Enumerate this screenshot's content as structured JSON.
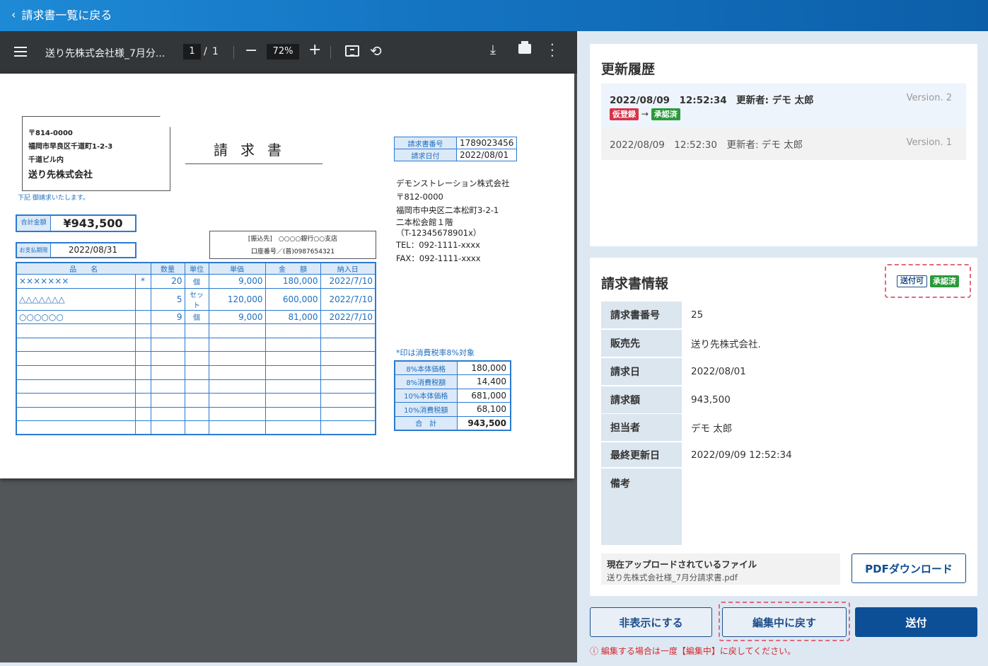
{
  "topbar": {
    "back_label": "請求書一覧に戻る"
  },
  "viewer": {
    "file_title": "送り先株式会社様_7月分...",
    "page_current": "1",
    "page_sep": "/",
    "page_total": "1",
    "zoom": "72%",
    "icons": [
      "menu-icon",
      "minus-icon",
      "plus-icon",
      "fit-page-icon",
      "rotate-icon",
      "download-icon",
      "print-icon",
      "more-vert-icon"
    ]
  },
  "invoice": {
    "postal": "〒814-0000",
    "address1": "福岡市早良区千道町1-2-3",
    "address2": "千道ビル内",
    "recipient": "送り先株式会社",
    "title": "請求書",
    "note": "下記 御請求いたします。",
    "total_label": "合計金額",
    "total_value": "¥943,500",
    "due_label": "お支払期限",
    "due_value": "2022/08/31",
    "bank_line1": "[振込先]　○○○○銀行○○支店",
    "bank_line2": "口座番号／(普)0987654321",
    "meta": {
      "number_label": "請求書番号",
      "number_value": "1789023456",
      "date_label": "請求日付",
      "date_value": "2022/08/01"
    },
    "issuer": {
      "name": "デモンストレーション株式会社",
      "postal": "〒812-0000",
      "address1": "福岡市中央区二本松町3-2-1",
      "address2": "二本松会館１階",
      "reg": "（T-12345678901x）",
      "tel": "TEL：092-1111-xxxx",
      "fax": "FAX：092-1111-xxxx"
    },
    "columns": [
      "品　　名",
      "",
      "数量",
      "単位",
      "単価",
      "金　　額",
      "納入日"
    ],
    "items": [
      [
        "×××××××",
        "*",
        "20",
        "個",
        "9,000",
        "180,000",
        "2022/7/10"
      ],
      [
        "△△△△△△△",
        "",
        "5",
        "セット",
        "120,000",
        "600,000",
        "2022/7/10"
      ],
      [
        "○○○○○○",
        "",
        "9",
        "個",
        "9,000",
        "81,000",
        "2022/7/10"
      ]
    ],
    "tax_note": "*印は消費税率8%対象",
    "tax": [
      {
        "label": "8%本体価格",
        "value": "180,000"
      },
      {
        "label": "8%消費税額",
        "value": "14,400"
      },
      {
        "label": "10%本体価格",
        "value": "681,000"
      },
      {
        "label": "10%消費税額",
        "value": "68,100"
      },
      {
        "label": "合　計",
        "value": "943,500"
      }
    ]
  },
  "history": {
    "title": "更新履歴",
    "entries": [
      {
        "text": "2022/08/09　12:52:34　更新者: デモ 太郎",
        "version": "Version. 2",
        "from": "仮登録",
        "arrow": "→",
        "to": "承認済"
      },
      {
        "text": "2022/08/09　12:52:30　更新者: デモ 太郎",
        "version": "Version. 1"
      }
    ]
  },
  "info": {
    "title": "請求書情報",
    "badge_send": "送付可",
    "badge_status": "承認済",
    "rows": [
      {
        "key": "請求書番号",
        "value": "25"
      },
      {
        "key": "販売先",
        "value": "送り先株式会社."
      },
      {
        "key": "請求日",
        "value": "2022/08/01"
      },
      {
        "key": "請求額",
        "value": "943,500"
      },
      {
        "key": "担当者",
        "value": "デモ 太郎"
      },
      {
        "key": "最終更新日",
        "value": "2022/09/09 12:52:34"
      },
      {
        "key": "備考",
        "value": ""
      }
    ],
    "file_label": "現在アップロードされているファイル",
    "file_name": "送り先株式会社様_7月分請求書.pdf",
    "pdf_button": "PDFダウンロード"
  },
  "actions": {
    "hide": "非表示にする",
    "back_to_edit": "編集中に戻す",
    "send": "送付",
    "warning": "ⓘ 編集する場合は一度【編集中】に戻してください。"
  },
  "colors": {
    "accent": "#0c4f96",
    "topbar": "#1576c4",
    "approved": "#2a9a3a",
    "provisional": "#d9334a"
  }
}
